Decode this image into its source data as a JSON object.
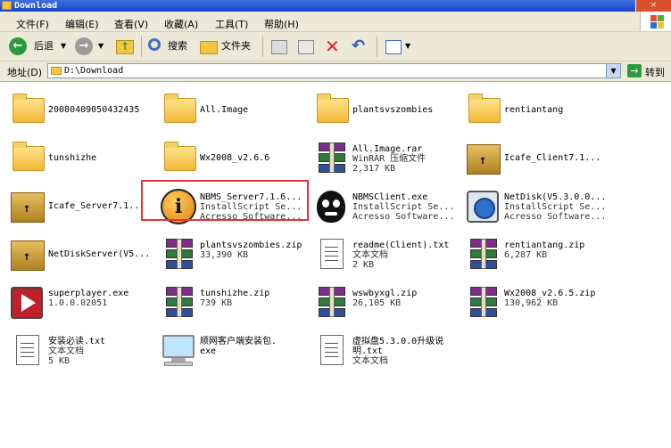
{
  "window": {
    "title": "Download"
  },
  "menu": [
    "文件(F)",
    "编辑(E)",
    "查看(V)",
    "收藏(A)",
    "工具(T)",
    "帮助(H)"
  ],
  "toolbar": {
    "back": "后退",
    "search": "搜索",
    "folders": "文件夹"
  },
  "address": {
    "label": "地址(D)",
    "value": "D:\\Download",
    "go": "转到"
  },
  "files": [
    {
      "icon": "folder-icon",
      "lines": [
        "20080409050432435"
      ]
    },
    {
      "icon": "folder-icon",
      "lines": [
        "All.Image"
      ]
    },
    {
      "icon": "folder-icon",
      "lines": [
        "plantsvszombies"
      ]
    },
    {
      "icon": "folder-icon",
      "lines": [
        "rentiantang"
      ]
    },
    {
      "icon": "folder-icon",
      "lines": [
        "tunshizhe"
      ]
    },
    {
      "icon": "folder-icon",
      "lines": [
        "Wx2008_v2.6.6"
      ]
    },
    {
      "icon": "winrar-icon",
      "lines": [
        "All.Image.rar",
        "WinRAR 压缩文件",
        "2,317 KB"
      ]
    },
    {
      "icon": "installer-box-icon",
      "lines": [
        "Icafe_Client7.1..."
      ]
    },
    {
      "icon": "installer-box-icon",
      "lines": [
        "Icafe_Server7.1..."
      ]
    },
    {
      "icon": "info-installer-icon",
      "lines": [
        "NBMS_Server7.1.6...",
        "InstallScript Se...",
        "Acresso Software..."
      ]
    },
    {
      "icon": "cartoon-client-icon",
      "lines": [
        "NBMSClient.exe",
        "InstallScript Se...",
        "Acresso Software..."
      ]
    },
    {
      "icon": "netdisk-icon",
      "lines": [
        "NetDisk(V5.3.0.0...",
        "InstallScript Se...",
        "Acresso Software..."
      ]
    },
    {
      "icon": "installer-box-icon",
      "lines": [
        "NetDiskServer(V5..."
      ]
    },
    {
      "icon": "winrar-icon",
      "lines": [
        "plantsvszombies.zip",
        "33,390 KB"
      ]
    },
    {
      "icon": "text-document-icon",
      "lines": [
        "readme(Client).txt",
        "文本文档",
        "2 KB"
      ]
    },
    {
      "icon": "winrar-icon",
      "lines": [
        "rentiantang.zip",
        "6,287 KB"
      ]
    },
    {
      "icon": "video-player-icon",
      "lines": [
        "superplayer.exe",
        "1.0.0.02051"
      ]
    },
    {
      "icon": "winrar-icon",
      "lines": [
        "tunshizhe.zip",
        "739 KB"
      ]
    },
    {
      "icon": "winrar-icon",
      "lines": [
        "wswbyxgl.zip",
        "26,105 KB"
      ]
    },
    {
      "icon": "winrar-icon",
      "lines": [
        "Wx2008_v2.6.5.zip",
        "130,962 KB"
      ]
    },
    {
      "icon": "text-document-icon",
      "lines": [
        "安装必读.txt",
        "文本文档",
        "5 KB"
      ]
    },
    {
      "icon": "computer-icon",
      "lines": [
        "顺网客户端安装包.",
        "exe"
      ]
    },
    {
      "icon": "text-document-icon",
      "lines": [
        "虚拟盘5.3.0.0升级说",
        "明.txt",
        "文本文档"
      ]
    }
  ]
}
